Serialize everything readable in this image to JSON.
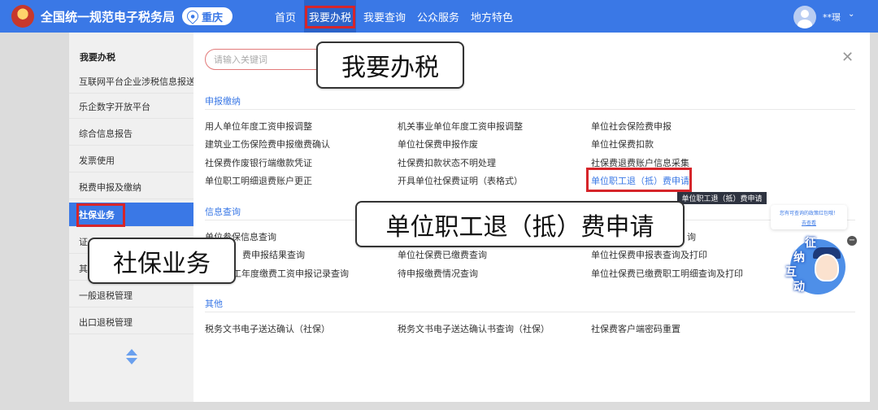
{
  "header": {
    "site_title": "全国统一规范电子税务局",
    "region": "重庆",
    "nav": [
      "首页",
      "我要办税",
      "我要查询",
      "公众服务",
      "地方特色"
    ],
    "active_nav": "我要办税",
    "username": "**璟",
    "colors": {
      "bar": "#3a78e6",
      "highlight": "#d6252a"
    }
  },
  "sidebar": {
    "title": "我要办税",
    "items": [
      "互联网平台企业涉税信息报送",
      "乐企数字开放平台",
      "综合信息报告",
      "发票使用",
      "税费申报及缴纳",
      "社保业务",
      "证",
      "其",
      "一般退税管理",
      "出口退税管理"
    ],
    "active": "社保业务"
  },
  "search": {
    "placeholder": "请输入关键词"
  },
  "sections": [
    {
      "title": "申报缴纳",
      "links": [
        "用人单位年度工资申报调整",
        "机关事业单位年度工资申报调整",
        "单位社会保险费申报",
        "建筑业工伤保险费申报缴费确认",
        "单位社保费申报作废",
        "单位社保费扣款",
        "社保费作废银行端缴款凭证",
        "社保费扣款状态不明处理",
        "社保费退费账户信息采集",
        "单位职工明细退费账户更正",
        "开具单位社保费证明（表格式）",
        "单位职工退（抵）费申请"
      ]
    },
    {
      "title": "信息查询",
      "links": [
        "单位参保信息查询",
        "",
        "询",
        "费申报结果查询",
        "单位社保费已缴费查询",
        "单位社保费申报表查询及打印",
        "工年度缴费工资申报记录查询",
        "待申报缴费情况查询",
        "单位社保费已缴费职工明细查询及打印"
      ]
    },
    {
      "title": "其他",
      "links": [
        "税务文书电子送达确认（社保）",
        "税务文书电子送达确认书查询（社保）",
        "社保费客户端密码重置"
      ]
    }
  ],
  "tooltip": "单位职工退（抵）费申请",
  "callouts": {
    "nav": "我要办税",
    "sidebar": "社保业务",
    "link": "单位职工退（抵）费申请"
  },
  "assistant": {
    "bubble_text": "您有可查询的政策红包哦！",
    "bubble_link": "去查看",
    "label": [
      "征",
      "纳",
      "互",
      "动"
    ]
  }
}
